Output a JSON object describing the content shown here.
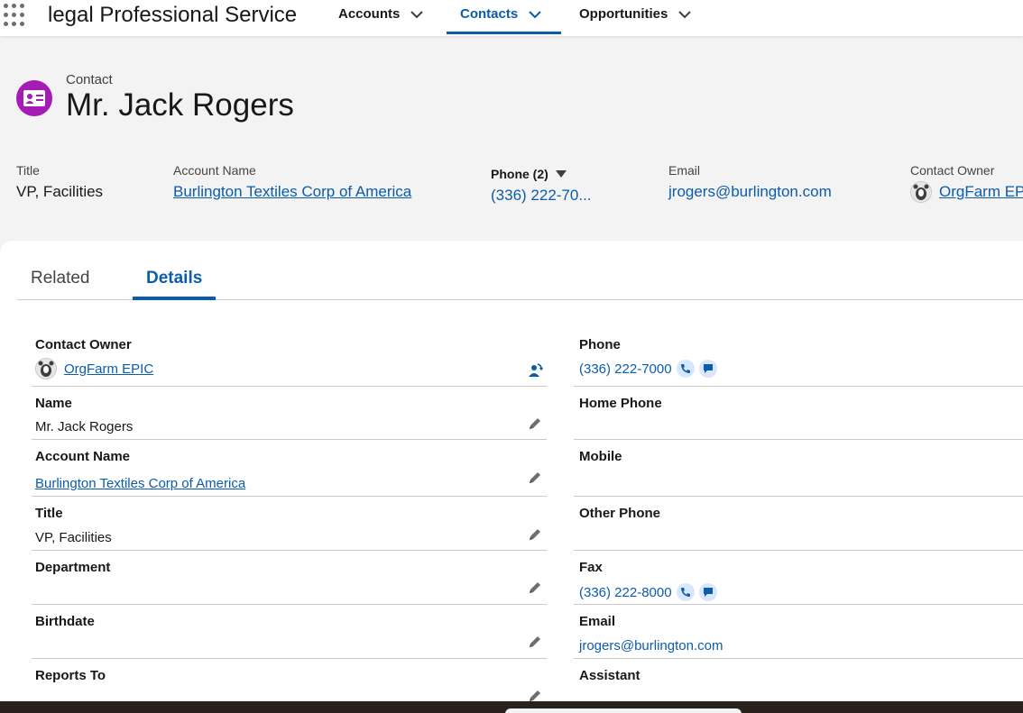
{
  "app": {
    "name": "legal Professional Service"
  },
  "nav": {
    "accounts": "Accounts",
    "contacts": "Contacts",
    "opportunities": "Opportunities"
  },
  "record": {
    "object_label": "Contact",
    "name": "Mr. Jack Rogers",
    "icon": "contact-card-icon",
    "icon_color": "#a41bb8"
  },
  "highlights": {
    "title_label": "Title",
    "title_value": "VP, Facilities",
    "account_label": "Account Name",
    "account_value": "Burlington Textiles Corp of America",
    "phone_label": "Phone (2)",
    "phone_value": "(336) 222-70...",
    "email_label": "Email",
    "email_value": "jrogers@burlington.com",
    "owner_label": "Contact Owner",
    "owner_value": "OrgFarm EP"
  },
  "tabs": {
    "related": "Related",
    "details": "Details",
    "active": "Details"
  },
  "details": {
    "contact_owner": {
      "label": "Contact Owner",
      "value": "OrgFarm EPIC"
    },
    "name": {
      "label": "Name",
      "value": "Mr. Jack Rogers"
    },
    "account_name": {
      "label": "Account Name",
      "value": "Burlington Textiles Corp of America"
    },
    "title": {
      "label": "Title",
      "value": "VP, Facilities"
    },
    "department": {
      "label": "Department",
      "value": ""
    },
    "birthdate": {
      "label": "Birthdate",
      "value": ""
    },
    "reports_to": {
      "label": "Reports To",
      "value": ""
    },
    "phone": {
      "label": "Phone",
      "value": "(336) 222-7000"
    },
    "home_phone": {
      "label": "Home Phone",
      "value": ""
    },
    "mobile": {
      "label": "Mobile",
      "value": ""
    },
    "other_phone": {
      "label": "Other Phone",
      "value": ""
    },
    "fax": {
      "label": "Fax",
      "value": "(336) 222-8000"
    },
    "email": {
      "label": "Email",
      "value": "jrogers@burlington.com"
    },
    "assistant": {
      "label": "Assistant",
      "value": ""
    }
  },
  "colors": {
    "brand_blue": "#0b5cab",
    "action_bg": "#d8e6fe"
  }
}
